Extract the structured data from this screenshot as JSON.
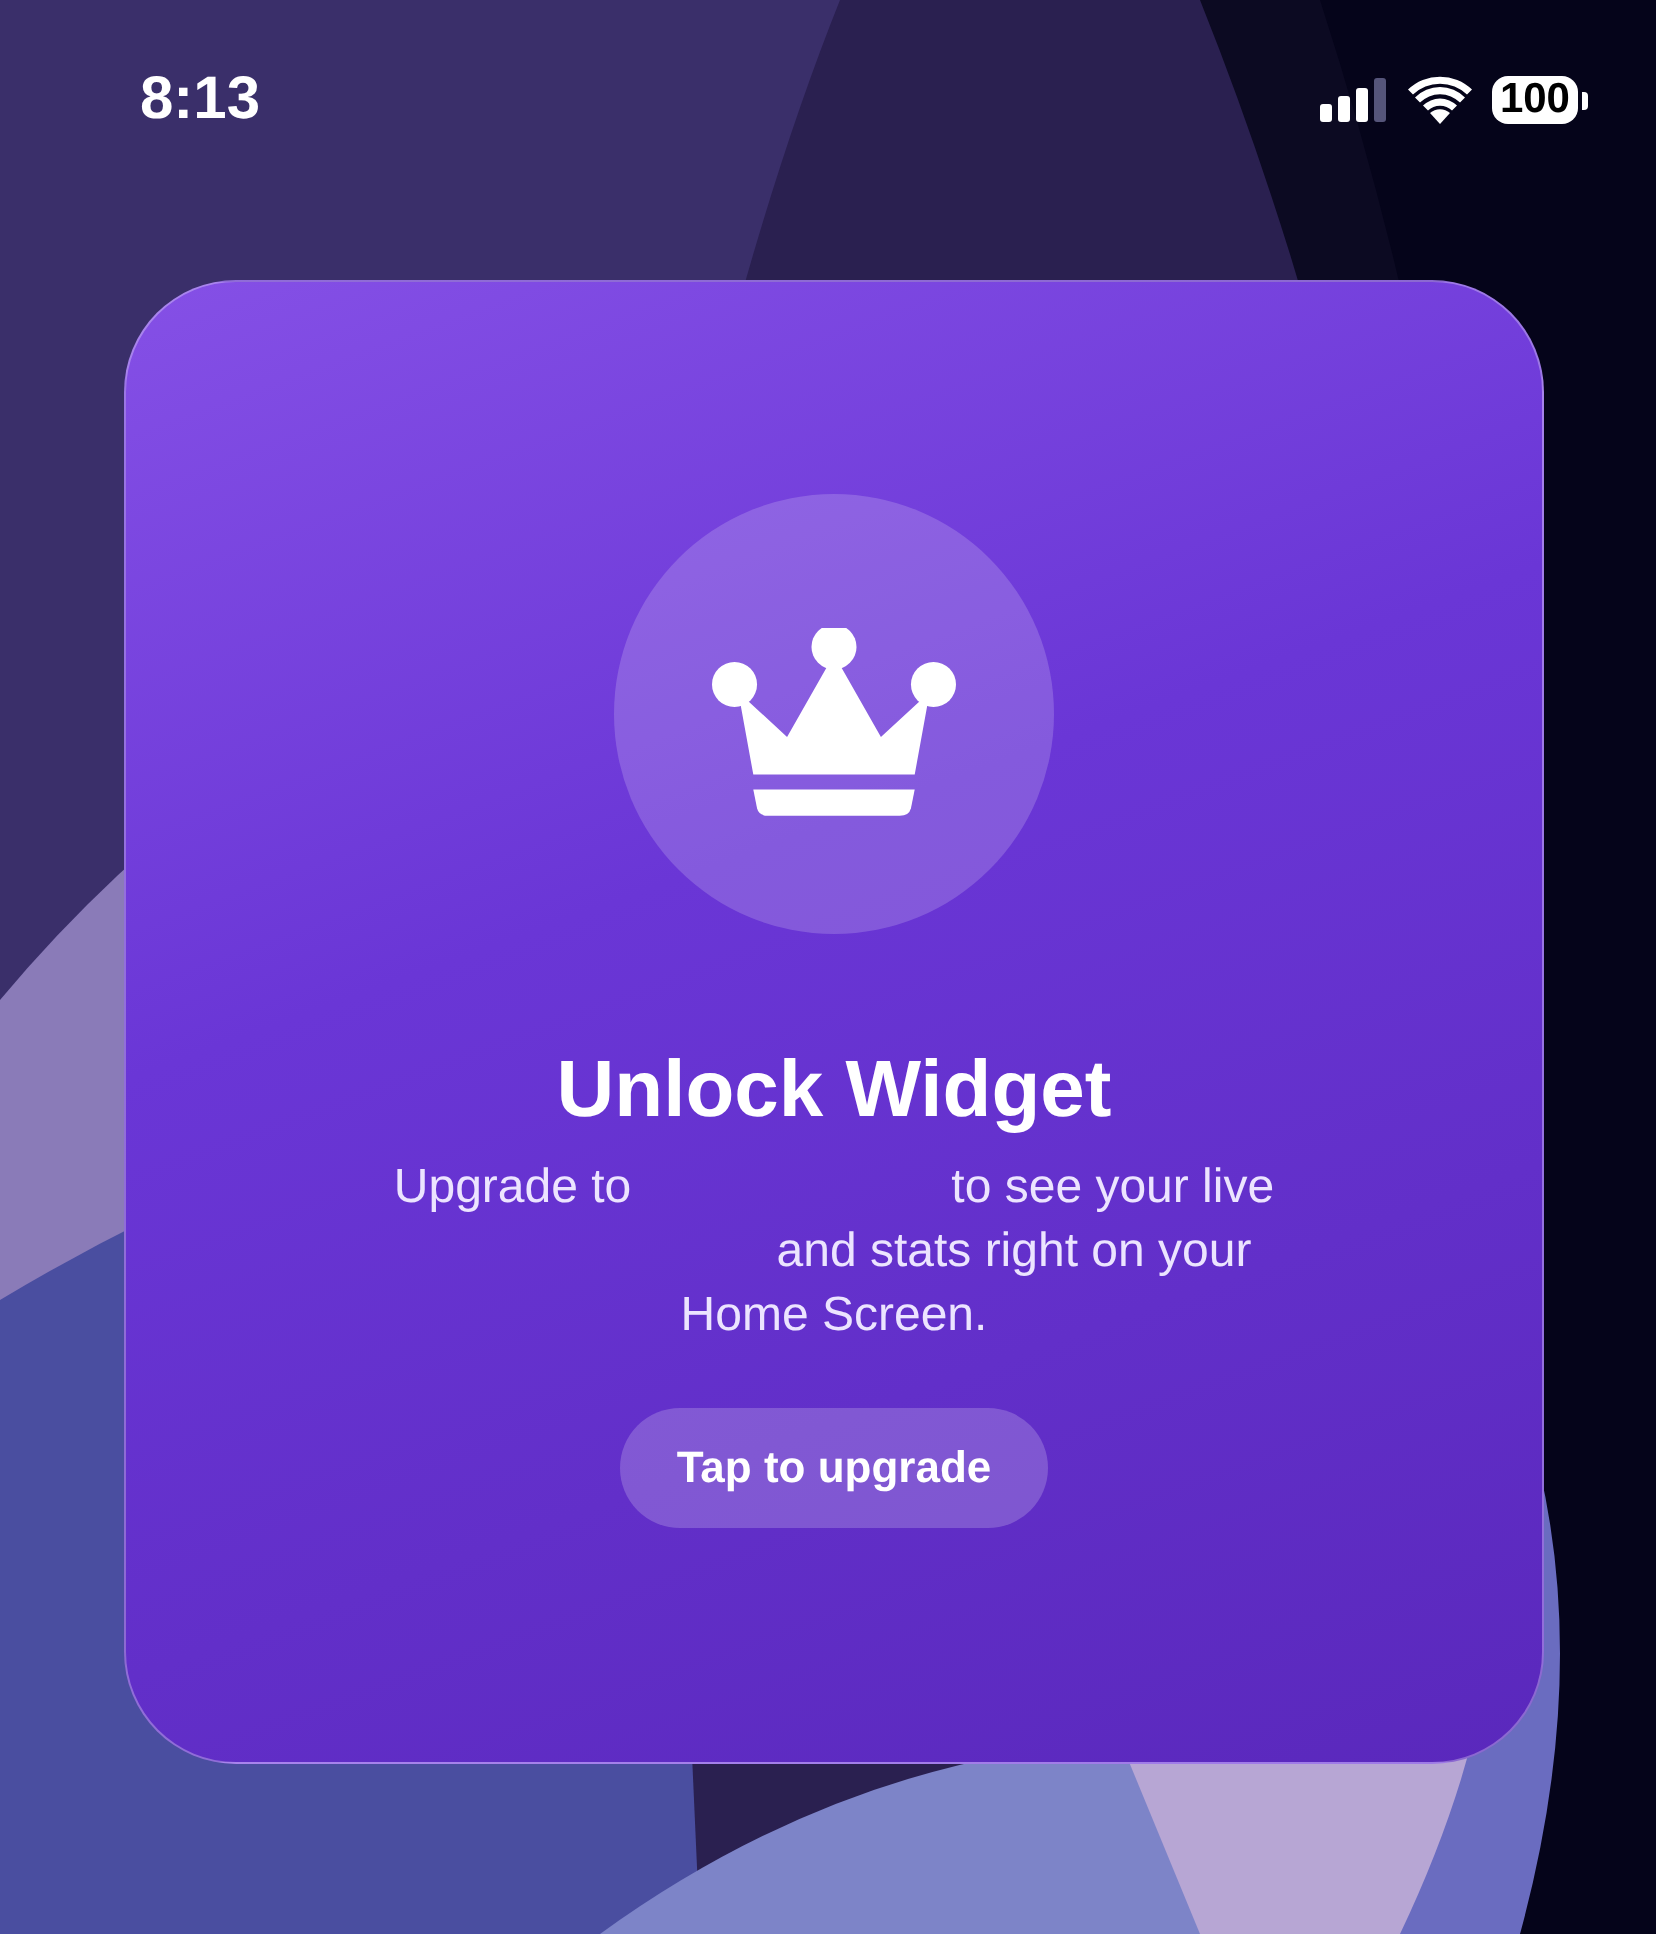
{
  "status_bar": {
    "time": "8:13",
    "battery": "100"
  },
  "widget": {
    "title": "Unlock Widget",
    "description_lines": [
      {
        "parts": [
          "Upgrade to",
          "to see your live"
        ]
      },
      {
        "lead_gap": true,
        "parts": [
          "and stats right on your"
        ]
      },
      {
        "parts": [
          "Home Screen."
        ]
      }
    ],
    "button": "Tap to upgrade"
  }
}
